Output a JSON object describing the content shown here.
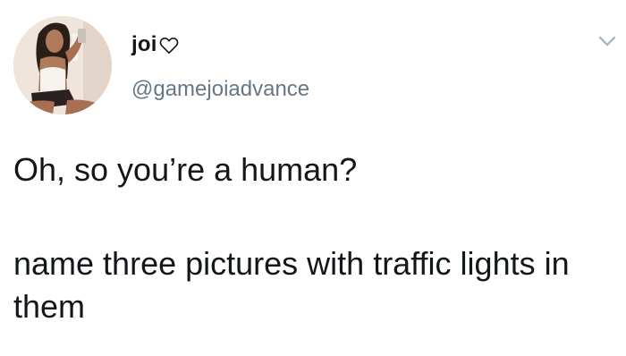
{
  "tweet": {
    "author": {
      "display_name": "joi",
      "handle": "@gamejoiadvance"
    },
    "text_line_1": "Oh, so you’re a human?",
    "text_line_2": "name three pictures with traffic lights in them"
  },
  "icons": {
    "name_emoji": "heart-outline-icon",
    "menu": "chevron-down-icon"
  },
  "colors": {
    "text": "#14171a",
    "secondary": "#657786",
    "chevron": "#aab8c2"
  }
}
